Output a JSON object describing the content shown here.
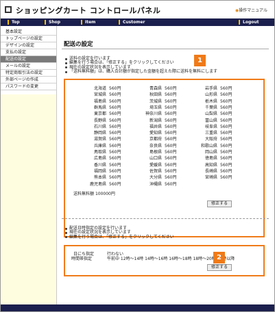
{
  "header": {
    "title": "ショッピングカート コントロールパネル",
    "manual_link": "操作マニュアル"
  },
  "nav": {
    "items": [
      "Top",
      "Shop",
      "Item",
      "Customer"
    ],
    "logout": "Logout"
  },
  "sidebar": {
    "items": [
      {
        "label": "基本設定",
        "active": false
      },
      {
        "label": "トップページの設定",
        "active": false
      },
      {
        "label": "デザインの設定",
        "active": false
      },
      {
        "label": "支払の設定",
        "active": false
      },
      {
        "label": "配送の設定",
        "active": true
      },
      {
        "label": "メールの設定",
        "active": false
      },
      {
        "label": "特定商取引法の設定",
        "active": false
      },
      {
        "label": "外部ページの作成",
        "active": false
      },
      {
        "label": "パスワードの変更",
        "active": false
      }
    ]
  },
  "main": {
    "title": "配送の設定",
    "intro_bullets": [
      "送料の設定を行います",
      "編集を行う場合は、「修正する」をクリックしてください",
      "現在の設定状況を表示しています",
      "「送料無料額」は、購入合計額が指定した金額を超えた際に送料を無料にします"
    ],
    "shipping": {
      "rows": [
        [
          {
            "pref": "北海道",
            "price": "560円"
          },
          {
            "pref": "青森県",
            "price": "560円"
          },
          {
            "pref": "岩手県",
            "price": "560円"
          }
        ],
        [
          {
            "pref": "宮城県",
            "price": "560円"
          },
          {
            "pref": "秋田県",
            "price": "560円"
          },
          {
            "pref": "山形県",
            "price": "560円"
          }
        ],
        [
          {
            "pref": "福島県",
            "price": "560円"
          },
          {
            "pref": "茨城県",
            "price": "560円"
          },
          {
            "pref": "栃木県",
            "price": "560円"
          }
        ],
        [
          {
            "pref": "群馬県",
            "price": "560円"
          },
          {
            "pref": "埼玉県",
            "price": "560円"
          },
          {
            "pref": "千葉県",
            "price": "560円"
          }
        ],
        [
          {
            "pref": "東京都",
            "price": "560円"
          },
          {
            "pref": "神奈川県",
            "price": "560円"
          },
          {
            "pref": "山梨県",
            "price": "560円"
          }
        ],
        [
          {
            "pref": "長野県",
            "price": "560円"
          },
          {
            "pref": "新潟県",
            "price": "560円"
          },
          {
            "pref": "富山県",
            "price": "560円"
          }
        ],
        [
          {
            "pref": "石川県",
            "price": "560円"
          },
          {
            "pref": "福井県",
            "price": "560円"
          },
          {
            "pref": "岐阜県",
            "price": "560円"
          }
        ],
        [
          {
            "pref": "静岡県",
            "price": "560円"
          },
          {
            "pref": "愛知県",
            "price": "560円"
          },
          {
            "pref": "三重県",
            "price": "560円"
          }
        ],
        [
          {
            "pref": "滋賀県",
            "price": "560円"
          },
          {
            "pref": "京都府",
            "price": "560円"
          },
          {
            "pref": "大阪府",
            "price": "560円"
          }
        ],
        [
          {
            "pref": "兵庫県",
            "price": "560円"
          },
          {
            "pref": "奈良県",
            "price": "560円"
          },
          {
            "pref": "和歌山県",
            "price": "560円"
          }
        ],
        [
          {
            "pref": "鳥取県",
            "price": "560円"
          },
          {
            "pref": "島根県",
            "price": "560円"
          },
          {
            "pref": "岡山県",
            "price": "560円"
          }
        ],
        [
          {
            "pref": "広島県",
            "price": "560円"
          },
          {
            "pref": "山口県",
            "price": "560円"
          },
          {
            "pref": "徳島県",
            "price": "560円"
          }
        ],
        [
          {
            "pref": "香川県",
            "price": "560円"
          },
          {
            "pref": "愛媛県",
            "price": "560円"
          },
          {
            "pref": "高知県",
            "price": "560円"
          }
        ],
        [
          {
            "pref": "福岡県",
            "price": "560円"
          },
          {
            "pref": "佐賀県",
            "price": "560円"
          },
          {
            "pref": "長崎県",
            "price": "560円"
          }
        ],
        [
          {
            "pref": "熊本県",
            "price": "560円"
          },
          {
            "pref": "大分県",
            "price": "560円"
          },
          {
            "pref": "宮崎県",
            "price": "560円"
          }
        ],
        [
          {
            "pref": "鹿児島県",
            "price": "560円"
          },
          {
            "pref": "沖縄県",
            "price": "560円"
          },
          null
        ]
      ],
      "free_shipping_label": "送料無料額",
      "free_shipping_value": "100000円",
      "edit_button": "修正する",
      "badge": "1"
    },
    "date_bullets": [
      "配送日時指定の設定を行います",
      "現在の設定状況を表示しています",
      "編集を行う場合は、「修正する」をクリックしてください"
    ],
    "date_settings": {
      "day_label": "日にち指定",
      "day_value": "行わない",
      "time_label": "時間帯指定",
      "time_value": "午前中 12時〜14時 14時〜16時 16時〜18時 18時〜20時 20時以降",
      "edit_button": "修正する",
      "badge": "2"
    }
  },
  "colors": {
    "navbar": "#1b1f4d",
    "nav_separator": "#f3c400",
    "highlight": "#f07a18",
    "sidebar_active": "#7a7a7a",
    "sidebar_bg": "#fffde0"
  }
}
